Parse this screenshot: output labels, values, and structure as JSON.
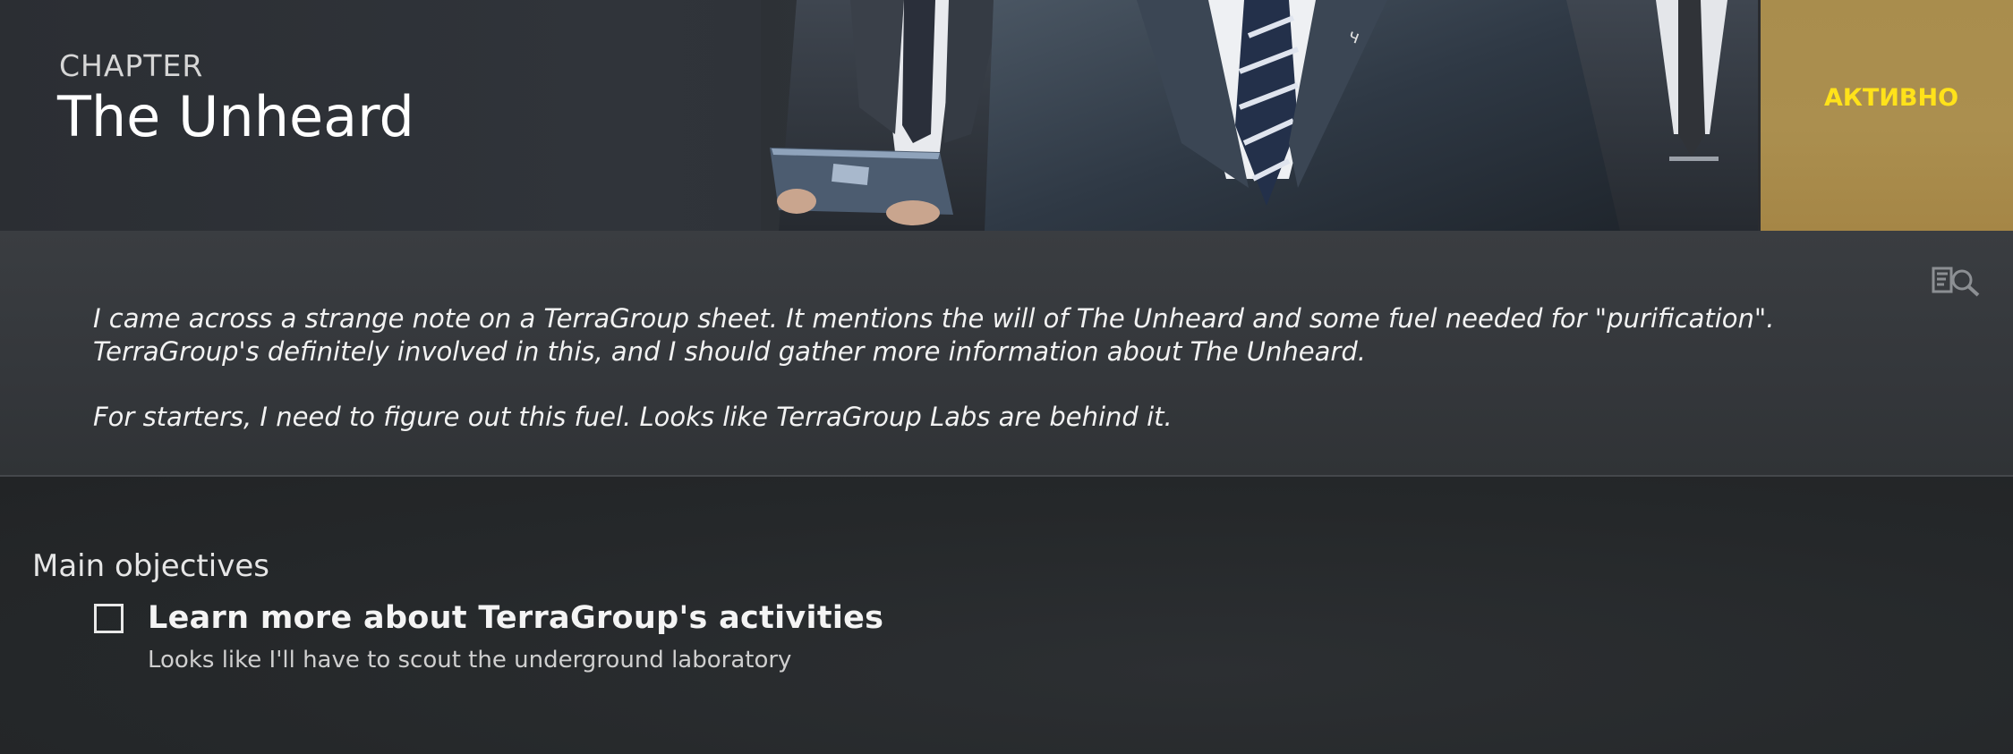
{
  "header": {
    "chapter_label": "CHAPTER",
    "title": "The Unheard",
    "status": "АКТИВНО",
    "banner_image": "three men in dark suits, one holding a folder",
    "status_color": "#ffe21a",
    "status_panel_color": "#a98d4d"
  },
  "description": {
    "log_icon": "quest-log-search-icon",
    "paragraphs": [
      "I came across a strange note on a TerraGroup sheet. It mentions the will of The Unheard and some fuel needed for \"purification\". TerraGroup's definitely involved in this, and I should gather more information about The Unheard.",
      "For starters, I need to figure out this fuel. Looks like TerraGroup Labs are behind it."
    ]
  },
  "objectives": {
    "heading": "Main objectives",
    "items": [
      {
        "title": "Learn more about TerraGroup's activities",
        "subtitle": "Looks like I'll have to scout the underground laboratory",
        "completed": false
      }
    ]
  }
}
